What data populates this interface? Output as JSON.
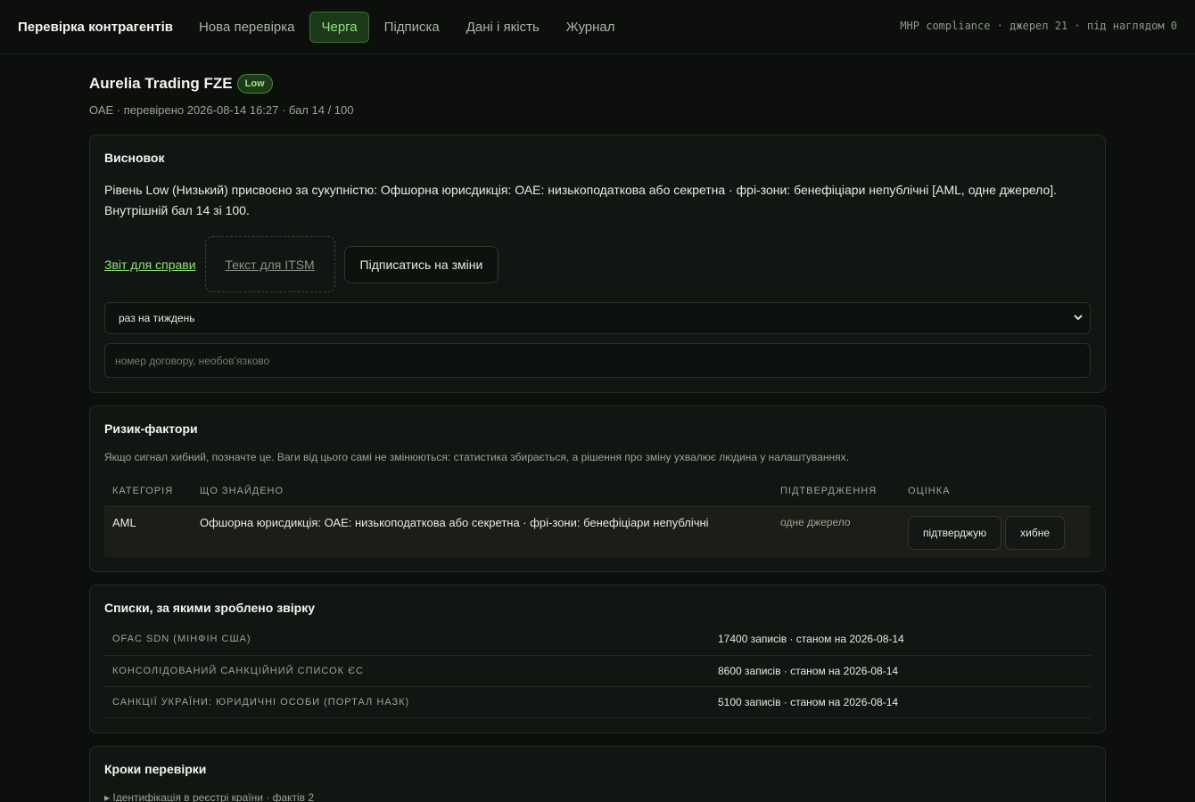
{
  "nav": {
    "brand": "Перевірка контрагентів",
    "items": [
      {
        "label": "Нова перевірка"
      },
      {
        "label": "Черга"
      },
      {
        "label": "Підписка"
      },
      {
        "label": "Дані і якість"
      },
      {
        "label": "Журнал"
      }
    ],
    "active_index": 1,
    "meta": "MHP compliance · джерел 21 · під наглядом 0"
  },
  "header": {
    "title": "Aurelia Trading FZE",
    "badge": "Low",
    "subtitle": "ОАЕ · перевірено 2026-08-14 16:27 · бал 14 / 100"
  },
  "conclusion": {
    "heading": "Висновок",
    "text": "Рівень Low (Низький) присвоєно за сукупністю: Офшорна юрисдикція: ОАЕ: низькоподаткова або секретна · фрі-зони: бенефіціари непублічні [AML, одне джерело]. Внутрішній бал 14 зі 100.",
    "report_link": "Звіт для справи",
    "itsm_button": "Текст для ITSM",
    "subscribe_button": "Підписатись на зміни",
    "frequency_selected": "раз на тиждень",
    "contract_placeholder": "номер договору, необов’язково"
  },
  "risk_factors": {
    "heading": "Ризик-фактори",
    "hint": "Якщо сигнал хибний, позначте це. Ваги від цього самі не змінюються: статистика збирається, а рішення про зміну ухвалює людина у налаштуваннях.",
    "columns": [
      "КАТЕГОРІЯ",
      "ЩО ЗНАЙДЕНО",
      "ПІДТВЕРДЖЕННЯ",
      "ОЦІНКА"
    ],
    "rows": [
      {
        "category": "AML",
        "finding": "Офшорна юрисдикція: ОАЕ: низькоподаткова або секретна · фрі-зони: бенефіціари непублічні",
        "confirmation": "одне джерело",
        "confirm_label": "підтверджую",
        "false_label": "хибне"
      }
    ]
  },
  "lists": {
    "heading": "Списки, за якими зроблено звірку",
    "items": [
      {
        "name": "OFAC SDN (МІНФІН США)",
        "info": "17400 записів · станом на 2026-08-14"
      },
      {
        "name": "КОНСОЛІДОВАНИЙ САНКЦІЙНИЙ СПИСОК ЄС",
        "info": "8600 записів · станом на 2026-08-14"
      },
      {
        "name": "САНКЦІЇ УКРАЇНИ: ЮРИДИЧНІ ОСОБИ (ПОРТАЛ НАЗК)",
        "info": "5100 записів · станом на 2026-08-14"
      }
    ]
  },
  "steps": {
    "heading": "Кроки перевірки",
    "first": "▸ Ідентифікація в реєстрі країни · фактів 2"
  }
}
